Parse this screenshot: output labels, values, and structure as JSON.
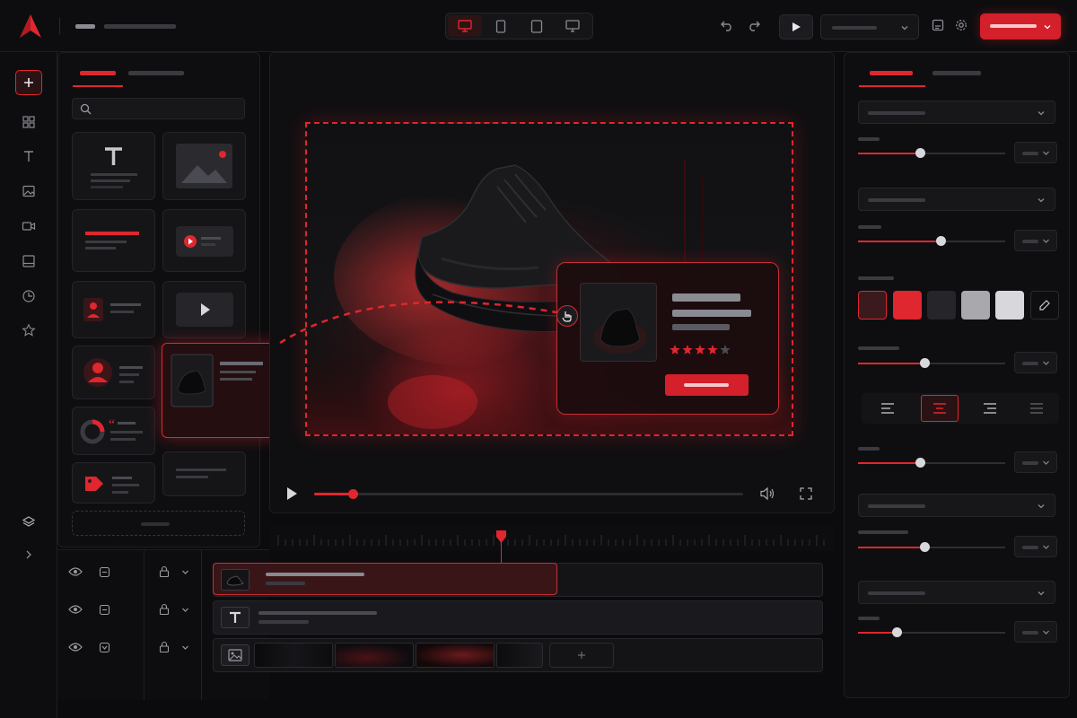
{
  "colors": {
    "accent": "#e0262e",
    "background": "#0b0b0d",
    "panel": "#0e0e10"
  },
  "toolbar": {
    "device_modes": [
      "desktop",
      "tablet",
      "tablet-landscape",
      "monitor"
    ],
    "active_device": "desktop"
  },
  "canvas": {
    "product_rating_stars": 4,
    "product_rating_max": 5
  },
  "playback": {
    "progress": 0.09
  },
  "properties": {
    "slider_levels": [
      0.42,
      0.56,
      0.45,
      0.42,
      0.45,
      0.26
    ],
    "swatches": [
      "#3a1a1c",
      "#e0262e",
      "#26262a",
      "#a8a8ad",
      "#d8d8dc"
    ],
    "alignment": [
      "left",
      "center",
      "right",
      "justify"
    ],
    "active_alignment": "center"
  },
  "icons": {
    "rail": [
      "grid-icon",
      "text-icon",
      "image-icon",
      "video-icon",
      "layout-icon",
      "timer-icon",
      "star-icon"
    ],
    "assets": [
      "text-icon",
      "image-icon",
      "video-icon",
      "play-icon",
      "user-icon",
      "quote-icon",
      "tag-icon"
    ]
  }
}
